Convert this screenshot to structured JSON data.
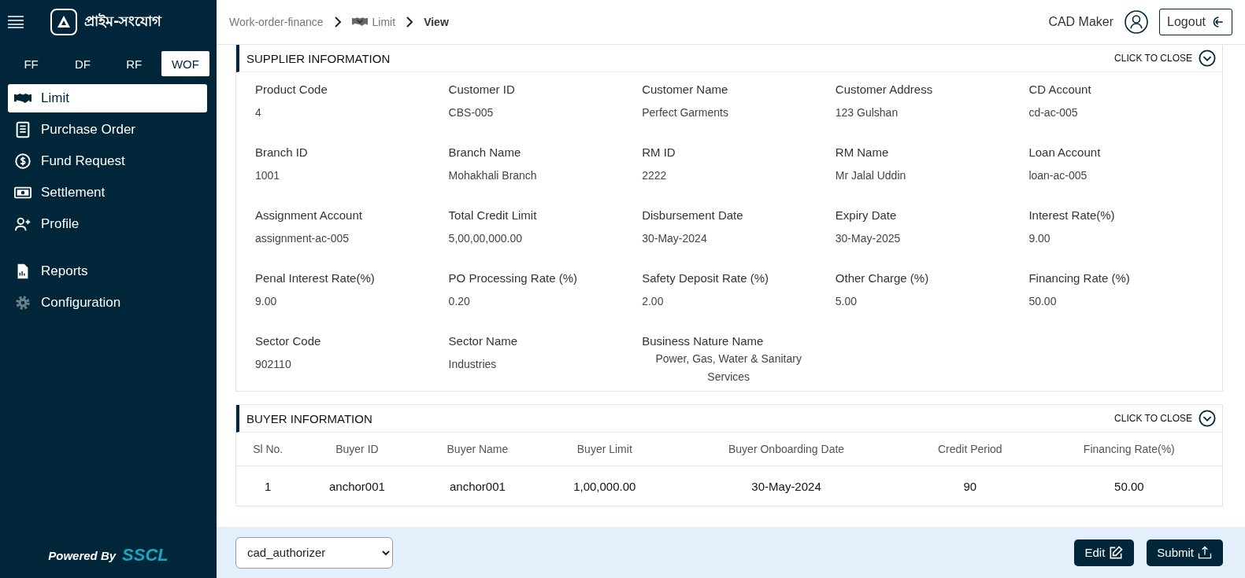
{
  "sidebar": {
    "logo_text": "প্রাইম-সংযোগ",
    "product_tabs": [
      {
        "label": "FF",
        "selected": false
      },
      {
        "label": "DF",
        "selected": false
      },
      {
        "label": "RF",
        "selected": false
      },
      {
        "label": "WOF",
        "selected": true
      }
    ],
    "menu_groups": [
      [
        {
          "label": "Limit",
          "selected": true
        },
        {
          "label": "Purchase Order",
          "selected": false
        },
        {
          "label": "Fund Request",
          "selected": false
        },
        {
          "label": "Settlement",
          "selected": false
        },
        {
          "label": "Profile",
          "selected": false
        }
      ],
      [
        {
          "label": "Reports",
          "selected": false
        },
        {
          "label": "Configuration",
          "selected": false
        }
      ]
    ],
    "powered_by": "Powered By",
    "brand": "SSCL"
  },
  "breadcrumb": [
    "Work-order-finance",
    "Limit",
    "View"
  ],
  "user": {
    "name": "CAD Maker",
    "logout": "Logout"
  },
  "supplier_information": {
    "title": "SUPPLIER INFORMATION",
    "toggle": "CLICK TO CLOSE",
    "fields": [
      {
        "label": "Product Code",
        "value": "4"
      },
      {
        "label": "Customer ID",
        "value": "CBS-005"
      },
      {
        "label": "Customer Name",
        "value": "Perfect Garments"
      },
      {
        "label": "Customer Address",
        "value": "123 Gulshan"
      },
      {
        "label": "CD Account",
        "value": "cd-ac-005"
      },
      {
        "label": "Branch ID",
        "value": "1001"
      },
      {
        "label": "Branch Name",
        "value": "Mohakhali Branch"
      },
      {
        "label": "RM ID",
        "value": "2222"
      },
      {
        "label": "RM Name",
        "value": "Mr Jalal Uddin"
      },
      {
        "label": "Loan Account",
        "value": "loan-ac-005"
      },
      {
        "label": "Assignment Account",
        "value": "assignment-ac-005"
      },
      {
        "label": "Total Credit Limit",
        "value": "5,00,00,000.00"
      },
      {
        "label": "Disbursement Date",
        "value": "30-May-2024"
      },
      {
        "label": "Expiry Date",
        "value": "30-May-2025"
      },
      {
        "label": "Interest Rate(%)",
        "value": "9.00"
      },
      {
        "label": "Penal Interest Rate(%)",
        "value": "9.00"
      },
      {
        "label": "PO Processing Rate (%)",
        "value": "0.20"
      },
      {
        "label": "Safety Deposit Rate (%)",
        "value": "2.00"
      },
      {
        "label": "Other Charge (%)",
        "value": "5.00"
      },
      {
        "label": "Financing Rate (%)",
        "value": "50.00"
      },
      {
        "label": "Sector Code",
        "value": "902110"
      },
      {
        "label": "Sector Name",
        "value": "Industries"
      },
      {
        "label": "Business Nature Name",
        "value": "Power, Gas, Water & Sanitary Services",
        "kind": "centered"
      }
    ]
  },
  "buyer_information": {
    "title": "BUYER INFORMATION",
    "toggle": "CLICK TO CLOSE",
    "columns": [
      "Sl No.",
      "Buyer ID",
      "Buyer Name",
      "Buyer Limit",
      "Buyer Onboarding Date",
      "Credit Period",
      "Financing Rate(%)"
    ],
    "rows": [
      [
        "1",
        "anchor001",
        "anchor001",
        "1,00,000.00",
        "30-May-2024",
        "90",
        "50.00"
      ]
    ]
  },
  "footer": {
    "role_select": "cad_authorizer",
    "buttons": [
      "Edit",
      "Submit"
    ]
  }
}
